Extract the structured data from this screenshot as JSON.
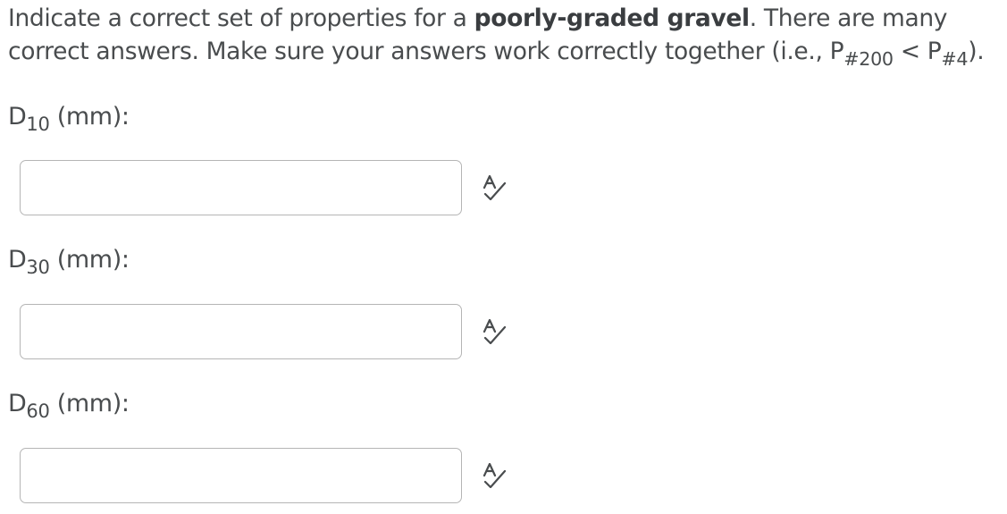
{
  "question": {
    "intro": "Indicate a correct set of properties for a ",
    "bold": "poorly-graded gravel",
    "middle": ".  There are many correct answers.  Make sure your answers work correctly together (i.e., P",
    "sub1": "#200",
    "lt": " < P",
    "sub2": "#4",
    "end": ")."
  },
  "fields": [
    {
      "main": "D",
      "sub": "10",
      "unit": " (mm):",
      "value": "",
      "icon": "spellcheck-icon"
    },
    {
      "main": "D",
      "sub": "30",
      "unit": " (mm):",
      "value": "",
      "icon": "spellcheck-icon"
    },
    {
      "main": "D",
      "sub": "60",
      "unit": " (mm):",
      "value": "",
      "icon": "spellcheck-icon"
    }
  ],
  "colors": {
    "text": "#494c4e",
    "input_border": "#b5b5b5",
    "icon": "#494c4e"
  }
}
